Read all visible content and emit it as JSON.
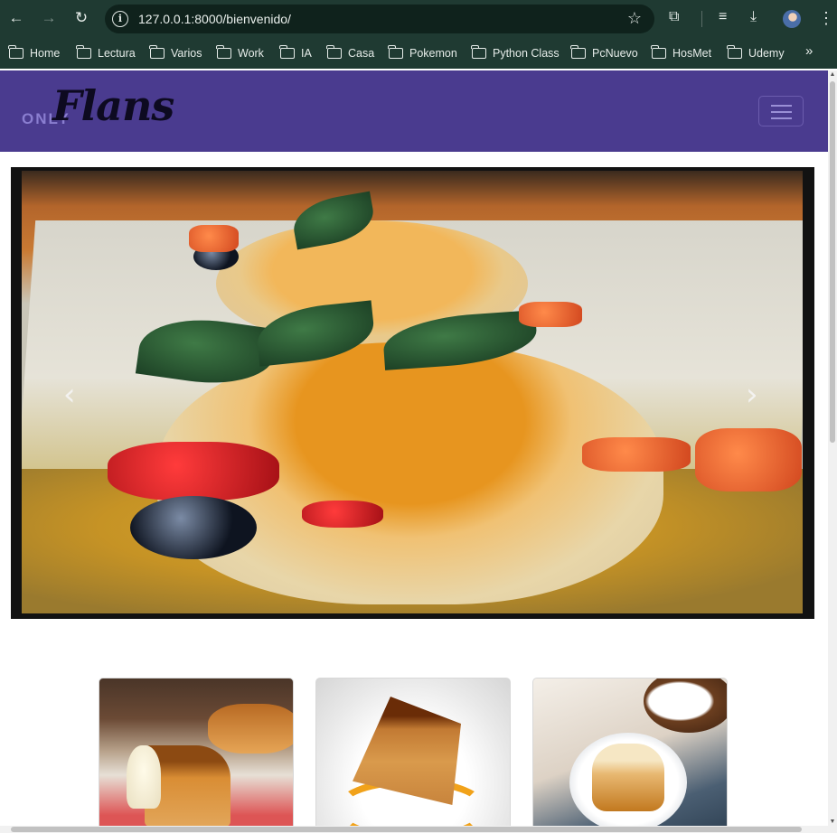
{
  "browser": {
    "url": "127.0.0.1:8000/bienvenido/",
    "bookmarks": [
      "Home",
      "Lectura",
      "Varios",
      "Work",
      "IA",
      "Casa",
      "Pokemon",
      "Python Class",
      "PcNuevo",
      "HosMet",
      "Udemy"
    ],
    "more_label": "»"
  },
  "site": {
    "brand_prefix": "ONLY",
    "brand_name": "Flans",
    "colors": {
      "navbar": "#4a3b8f",
      "chrome": "#1f3a32"
    }
  },
  "carousel": {
    "prev_label": "‹",
    "next_label": "›"
  }
}
